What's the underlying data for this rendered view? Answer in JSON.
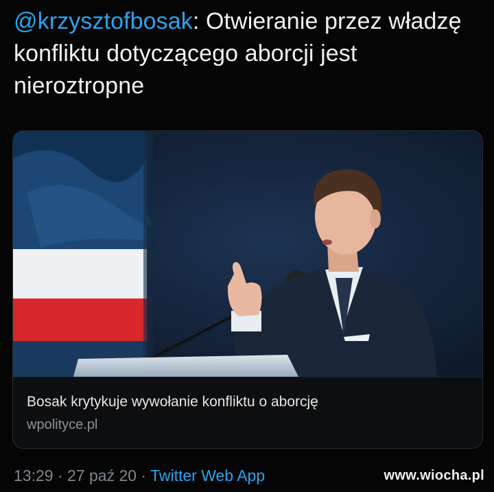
{
  "tweet": {
    "handle": "@krzysztofbosak",
    "separator": ": ",
    "text": "Otwieranie przez władzę konfliktu dotyczącego aborcji jest nieroztropne"
  },
  "link_card": {
    "title": "Bosak krytykuje wywołanie konfliktu o aborcję",
    "domain": "wpolityce.pl"
  },
  "meta": {
    "time": "13:29",
    "dot1": " · ",
    "date": "27 paź 20",
    "dot2": " · ",
    "app": "Twitter Web App"
  },
  "watermark": "www.wiocha.pl",
  "colors": {
    "background": "#050505",
    "link": "#2aa3ef",
    "muted": "#7f878f"
  }
}
